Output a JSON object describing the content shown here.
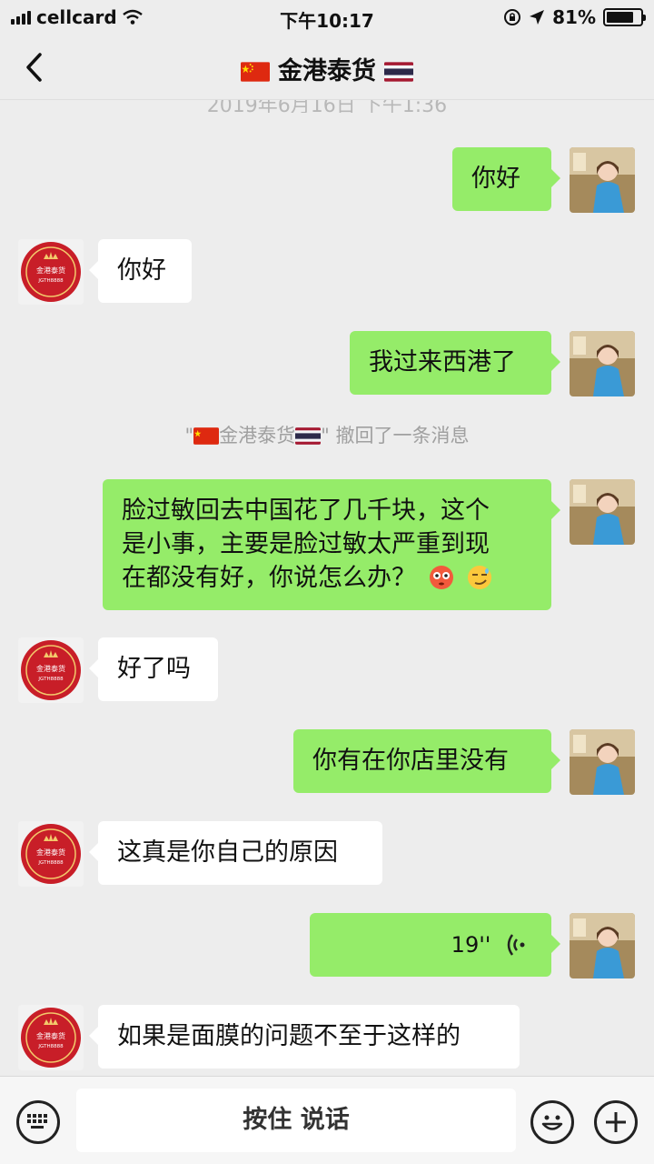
{
  "status": {
    "carrier": "cellcard",
    "time": "下午10:17",
    "battery": "81%",
    "battery_level": 0.81
  },
  "nav": {
    "title": "金港泰货"
  },
  "timestamp": "2019年6月16日 下午1:36",
  "avatar_badge": {
    "name": "金港泰货",
    "code": "JGTH8888"
  },
  "messages": [
    {
      "text": "你好"
    },
    {
      "text": "你好"
    },
    {
      "text": "我过来西港了"
    },
    {
      "line1": "脸过敏回去中国花了几千块，这个",
      "line2": "是小事，主要是脸过敏太严重到现",
      "line3": "在都没有好，你说怎么办？"
    },
    {
      "text": "好了吗"
    },
    {
      "text": "你有在你店里没有"
    },
    {
      "text": "这真是你自己的原因"
    },
    {
      "duration": "19''"
    },
    {
      "text": "如果是面膜的问题不至于这样的"
    }
  ],
  "recall_note": {
    "quote_open": "\"",
    "name": "金港泰货",
    "quote_close": "\"",
    "suffix": "撤回了一条消息"
  },
  "bottom": {
    "talk_label": "按住 说话"
  },
  "colors": {
    "out_bubble": "#95ec69",
    "in_bubble": "#ffffff",
    "background": "#ededed"
  }
}
